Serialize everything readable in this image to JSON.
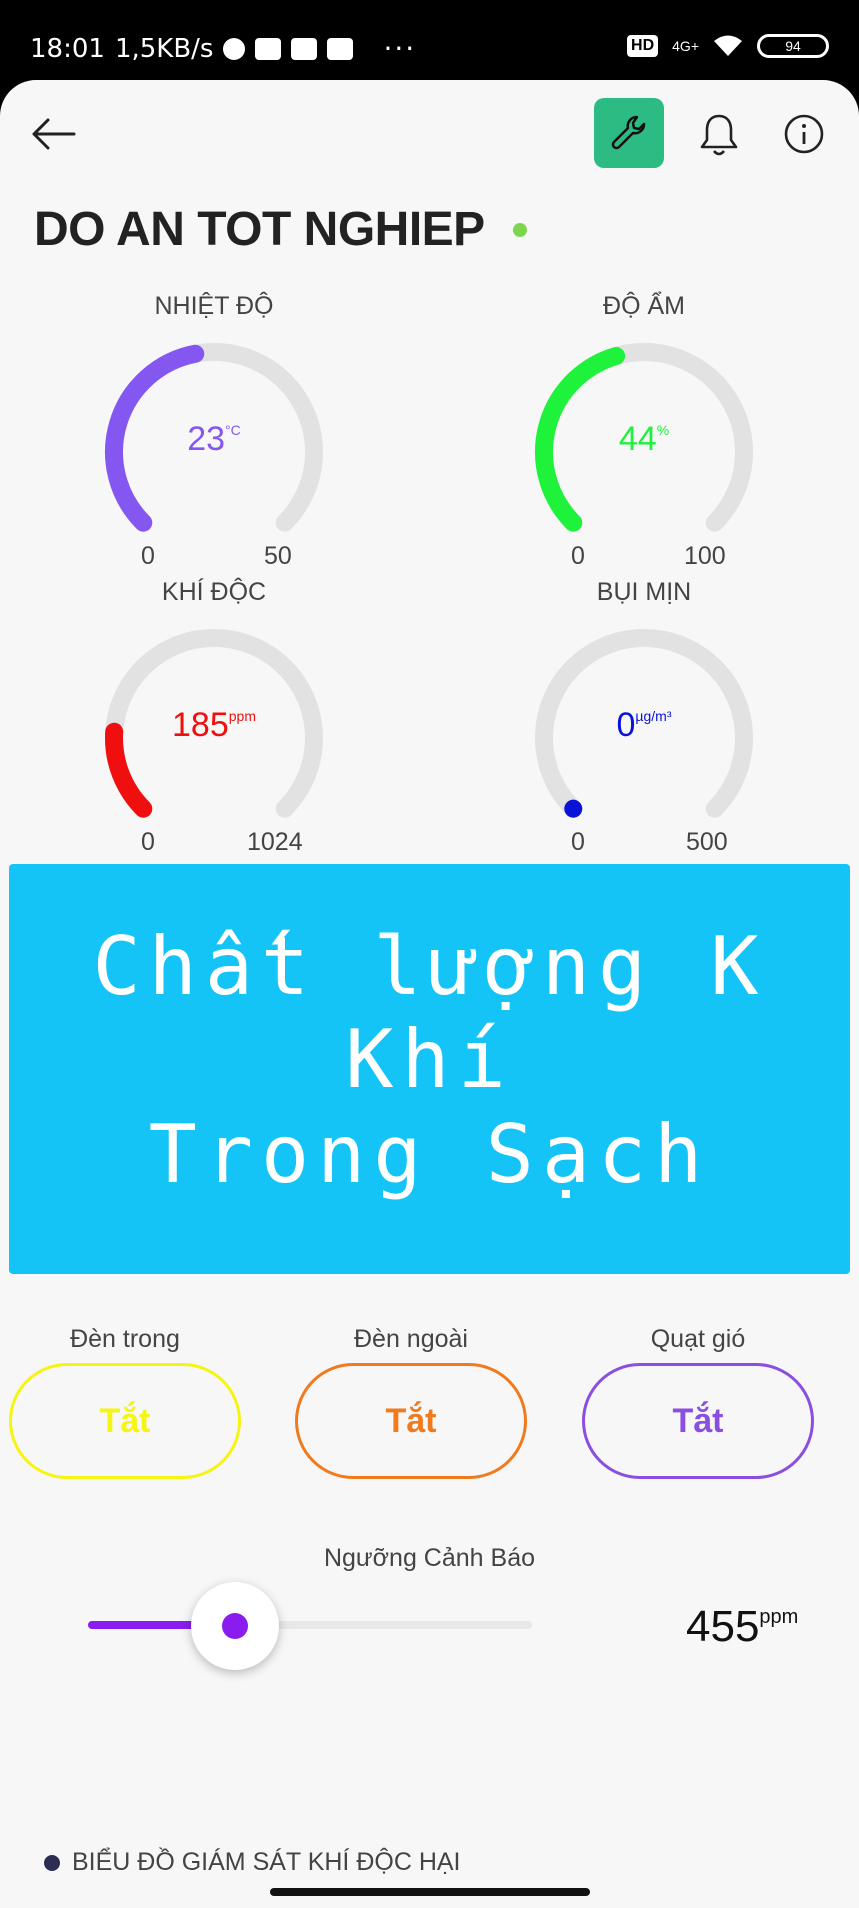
{
  "status_bar": {
    "time": "18:01",
    "speed": "1,5KB/s",
    "network": "4G+",
    "battery": "94",
    "hd": "HD"
  },
  "header": {
    "title": "DO AN TOT NGHIEP",
    "online_color": "#7cd44f",
    "accent_color": "#2dbb84"
  },
  "gauges": [
    {
      "label": "NHIỆT ĐỘ",
      "value": "23",
      "unit": "°C",
      "min": "0",
      "max": "50",
      "level": 0.46,
      "color": "#8457f0"
    },
    {
      "label": "ĐỘ ẨM",
      "value": "44",
      "unit": "%",
      "min": "0",
      "max": "100",
      "level": 0.44,
      "color": "#1ef23a"
    },
    {
      "label": "KHÍ ĐỘC",
      "value": "185",
      "unit": "ppm",
      "min": "0",
      "max": "1024",
      "level": 0.18,
      "color": "#f00f0f"
    },
    {
      "label": "BỤI MỊN",
      "value": "0",
      "unit": "µg/m³",
      "min": "0",
      "max": "500",
      "level": 0.0,
      "color": "#0a12d8"
    }
  ],
  "display": {
    "line1": "Chất lượng K Khí",
    "line2": "Trong Sạch",
    "background": "#15c4f7"
  },
  "controls": [
    {
      "label": "Đèn trong",
      "state": "Tắt",
      "color": "#f5f511"
    },
    {
      "label": "Đèn ngoài",
      "state": "Tắt",
      "color": "#f07a1e"
    },
    {
      "label": "Quạt gió",
      "state": "Tắt",
      "color": "#8a4fe0"
    }
  ],
  "threshold": {
    "label": "Ngưỡng Cảnh Báo",
    "value": "455",
    "unit": "ppm",
    "level": 0.455,
    "color": "#8a1cf0"
  },
  "chart_section": {
    "title": "BIỂU ĐỒ GIÁM SÁT KHÍ ĐỘC HẠI"
  }
}
